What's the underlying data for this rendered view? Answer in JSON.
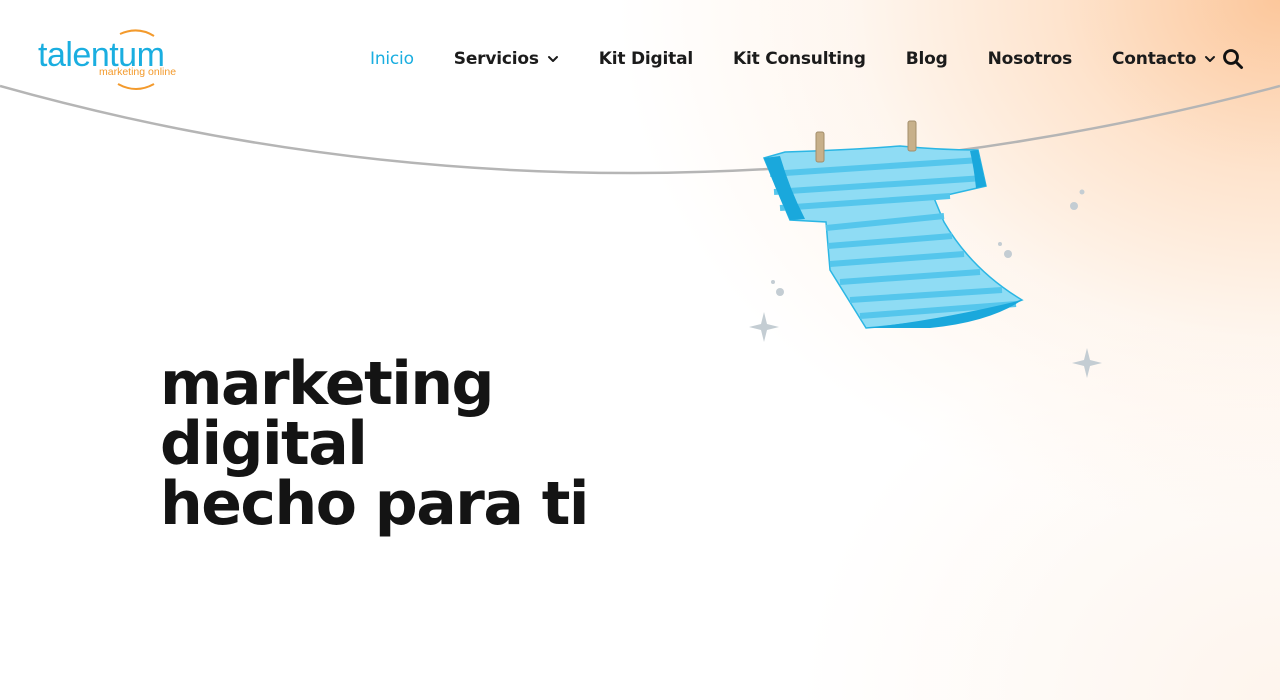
{
  "brand": {
    "name": "talentum",
    "tagline": "marketing online",
    "primary_color": "#1aaee0",
    "accent_color": "#f39a2c"
  },
  "nav": {
    "items": [
      {
        "label": "Inicio",
        "active": true,
        "dropdown": false
      },
      {
        "label": "Servicios",
        "active": false,
        "dropdown": true
      },
      {
        "label": "Kit Digital",
        "active": false,
        "dropdown": false
      },
      {
        "label": "Kit Consulting",
        "active": false,
        "dropdown": false
      },
      {
        "label": "Blog",
        "active": false,
        "dropdown": false
      },
      {
        "label": "Nosotros",
        "active": false,
        "dropdown": false
      },
      {
        "label": "Contacto",
        "active": false,
        "dropdown": true
      }
    ],
    "search_icon": "search-icon"
  },
  "hero": {
    "lines": [
      "marketing",
      "digital",
      "hecho para ti"
    ]
  },
  "illustration": {
    "subject": "t-shirt hanging on clothesline",
    "shirt_color": "#7fd8f3",
    "stripe_color": "#4cc3ea",
    "line_color": "#b3b3b3"
  }
}
